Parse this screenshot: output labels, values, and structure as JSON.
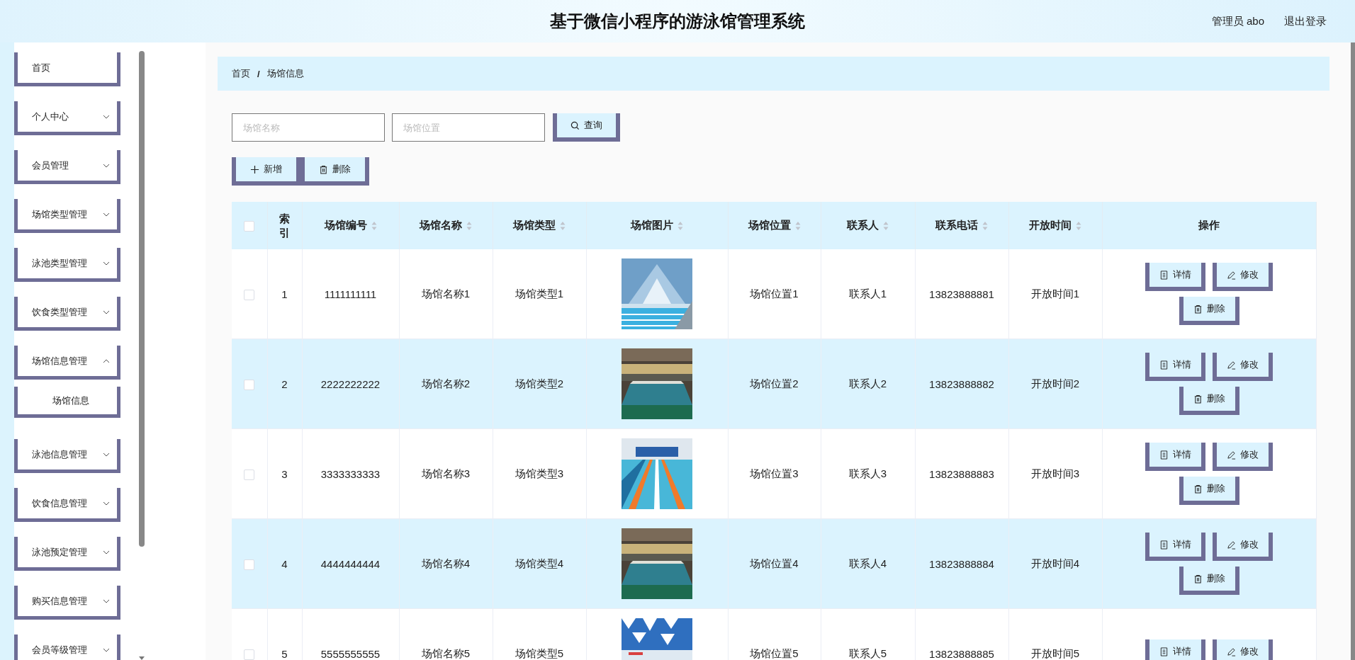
{
  "header": {
    "title": "基于微信小程序的游泳馆管理系统",
    "user": "管理员 abo",
    "logout": "退出登录"
  },
  "sidebar": {
    "items": [
      {
        "label": "首页",
        "kind": "link"
      },
      {
        "label": "个人中心",
        "kind": "submenu",
        "expanded": false
      },
      {
        "label": "会员管理",
        "kind": "submenu",
        "expanded": false
      },
      {
        "label": "场馆类型管理",
        "kind": "submenu",
        "expanded": false
      },
      {
        "label": "泳池类型管理",
        "kind": "submenu",
        "expanded": false
      },
      {
        "label": "饮食类型管理",
        "kind": "submenu",
        "expanded": false
      },
      {
        "label": "场馆信息管理",
        "kind": "submenu",
        "expanded": true,
        "children": [
          {
            "label": "场馆信息"
          }
        ]
      },
      {
        "label": "泳池信息管理",
        "kind": "submenu",
        "expanded": false
      },
      {
        "label": "饮食信息管理",
        "kind": "submenu",
        "expanded": false
      },
      {
        "label": "泳池预定管理",
        "kind": "submenu",
        "expanded": false
      },
      {
        "label": "购买信息管理",
        "kind": "submenu",
        "expanded": false
      },
      {
        "label": "会员等级管理",
        "kind": "submenu",
        "expanded": false
      }
    ]
  },
  "breadcrumb": {
    "items": [
      "首页",
      "场馆信息"
    ],
    "separator": "/"
  },
  "search": {
    "fields": [
      {
        "placeholder": "场馆名称"
      },
      {
        "placeholder": "场馆位置"
      }
    ],
    "button": "查询"
  },
  "toolbar": [
    {
      "label": "新增",
      "kind": "add"
    },
    {
      "label": "删除",
      "kind": "delete"
    }
  ],
  "table": {
    "select_all": {
      "checked": false
    },
    "columns": [
      {
        "label": "索引",
        "sortable": false
      },
      {
        "label": "场馆编号",
        "sortable": true
      },
      {
        "label": "场馆名称",
        "sortable": true
      },
      {
        "label": "场馆类型",
        "sortable": true
      },
      {
        "label": "场馆图片",
        "sortable": true
      },
      {
        "label": "场馆位置",
        "sortable": true
      },
      {
        "label": "联系人",
        "sortable": true
      },
      {
        "label": "联系电话",
        "sortable": true
      },
      {
        "label": "开放时间",
        "sortable": true
      },
      {
        "label": "操作",
        "sortable": false
      }
    ],
    "rows": [
      {
        "checked": false,
        "cells": [
          "1",
          "1111111111",
          "场馆名称1",
          "场馆类型1",
          {
            "kind": "picture"
          },
          "场馆位置1",
          "联系人1",
          "13823888881",
          "开放时间1"
        ],
        "actions": [
          {
            "label": "详情",
            "kind": "detail"
          },
          {
            "label": "修改",
            "kind": "edit"
          },
          {
            "label": "删除",
            "kind": "delete"
          }
        ]
      },
      {
        "checked": false,
        "cells": [
          "2",
          "2222222222",
          "场馆名称2",
          "场馆类型2",
          {
            "kind": "picture"
          },
          "场馆位置2",
          "联系人2",
          "13823888882",
          "开放时间2"
        ],
        "actions": [
          {
            "label": "详情",
            "kind": "detail"
          },
          {
            "label": "修改",
            "kind": "edit"
          },
          {
            "label": "删除",
            "kind": "delete"
          }
        ]
      },
      {
        "checked": false,
        "cells": [
          "3",
          "3333333333",
          "场馆名称3",
          "场馆类型3",
          {
            "kind": "picture"
          },
          "场馆位置3",
          "联系人3",
          "13823888883",
          "开放时间3"
        ],
        "actions": [
          {
            "label": "详情",
            "kind": "detail"
          },
          {
            "label": "修改",
            "kind": "edit"
          },
          {
            "label": "删除",
            "kind": "delete"
          }
        ]
      },
      {
        "checked": false,
        "cells": [
          "4",
          "4444444444",
          "场馆名称4",
          "场馆类型4",
          {
            "kind": "picture"
          },
          "场馆位置4",
          "联系人4",
          "13823888884",
          "开放时间4"
        ],
        "actions": [
          {
            "label": "详情",
            "kind": "detail"
          },
          {
            "label": "修改",
            "kind": "edit"
          },
          {
            "label": "删除",
            "kind": "delete"
          }
        ]
      },
      {
        "checked": false,
        "cells": [
          "5",
          "5555555555",
          "场馆名称5",
          "场馆类型5",
          {
            "kind": "picture"
          },
          "场馆位置5",
          "联系人5",
          "13823888885",
          "开放时间5"
        ],
        "actions": [
          {
            "label": "详情",
            "kind": "detail"
          },
          {
            "label": "修改",
            "kind": "edit"
          }
        ]
      }
    ]
  }
}
